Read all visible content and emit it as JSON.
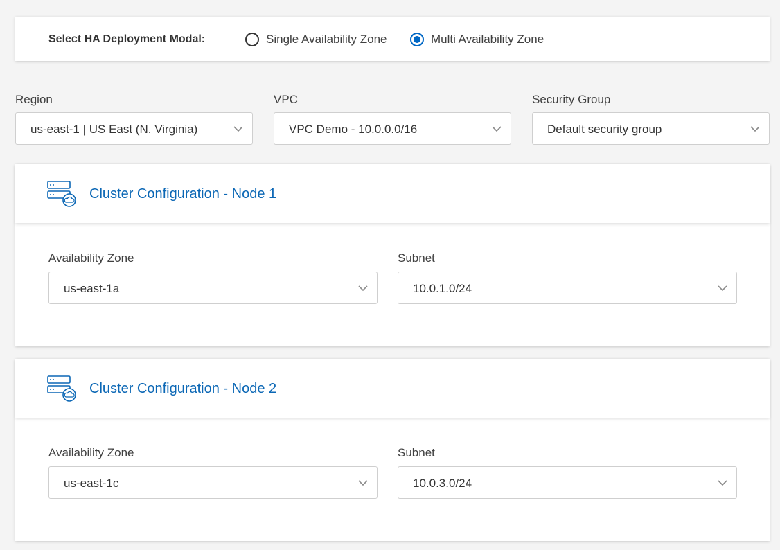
{
  "ha": {
    "label": "Select HA Deployment Modal:",
    "options": [
      {
        "label": "Single Availability Zone",
        "selected": false
      },
      {
        "label": "Multi Availability Zone",
        "selected": true
      }
    ]
  },
  "region": {
    "label": "Region",
    "value": "us-east-1 | US East (N. Virginia)"
  },
  "vpc": {
    "label": "VPC",
    "value": "VPC Demo - 10.0.0.0/16"
  },
  "security_group": {
    "label": "Security Group",
    "value": "Default security group"
  },
  "nodes": [
    {
      "title": "Cluster Configuration - Node 1",
      "az_label": "Availability Zone",
      "az_value": "us-east-1a",
      "subnet_label": "Subnet",
      "subnet_value": "10.0.1.0/24"
    },
    {
      "title": "Cluster Configuration - Node 2",
      "az_label": "Availability Zone",
      "az_value": "us-east-1c",
      "subnet_label": "Subnet",
      "subnet_value": "10.0.3.0/24"
    }
  ],
  "colors": {
    "accent": "#0067c5",
    "title_blue": "#0b67b5",
    "background": "#f4f4f4"
  },
  "icons": {
    "node": "server-cloud-icon",
    "dropdown": "chevron-down-icon"
  }
}
